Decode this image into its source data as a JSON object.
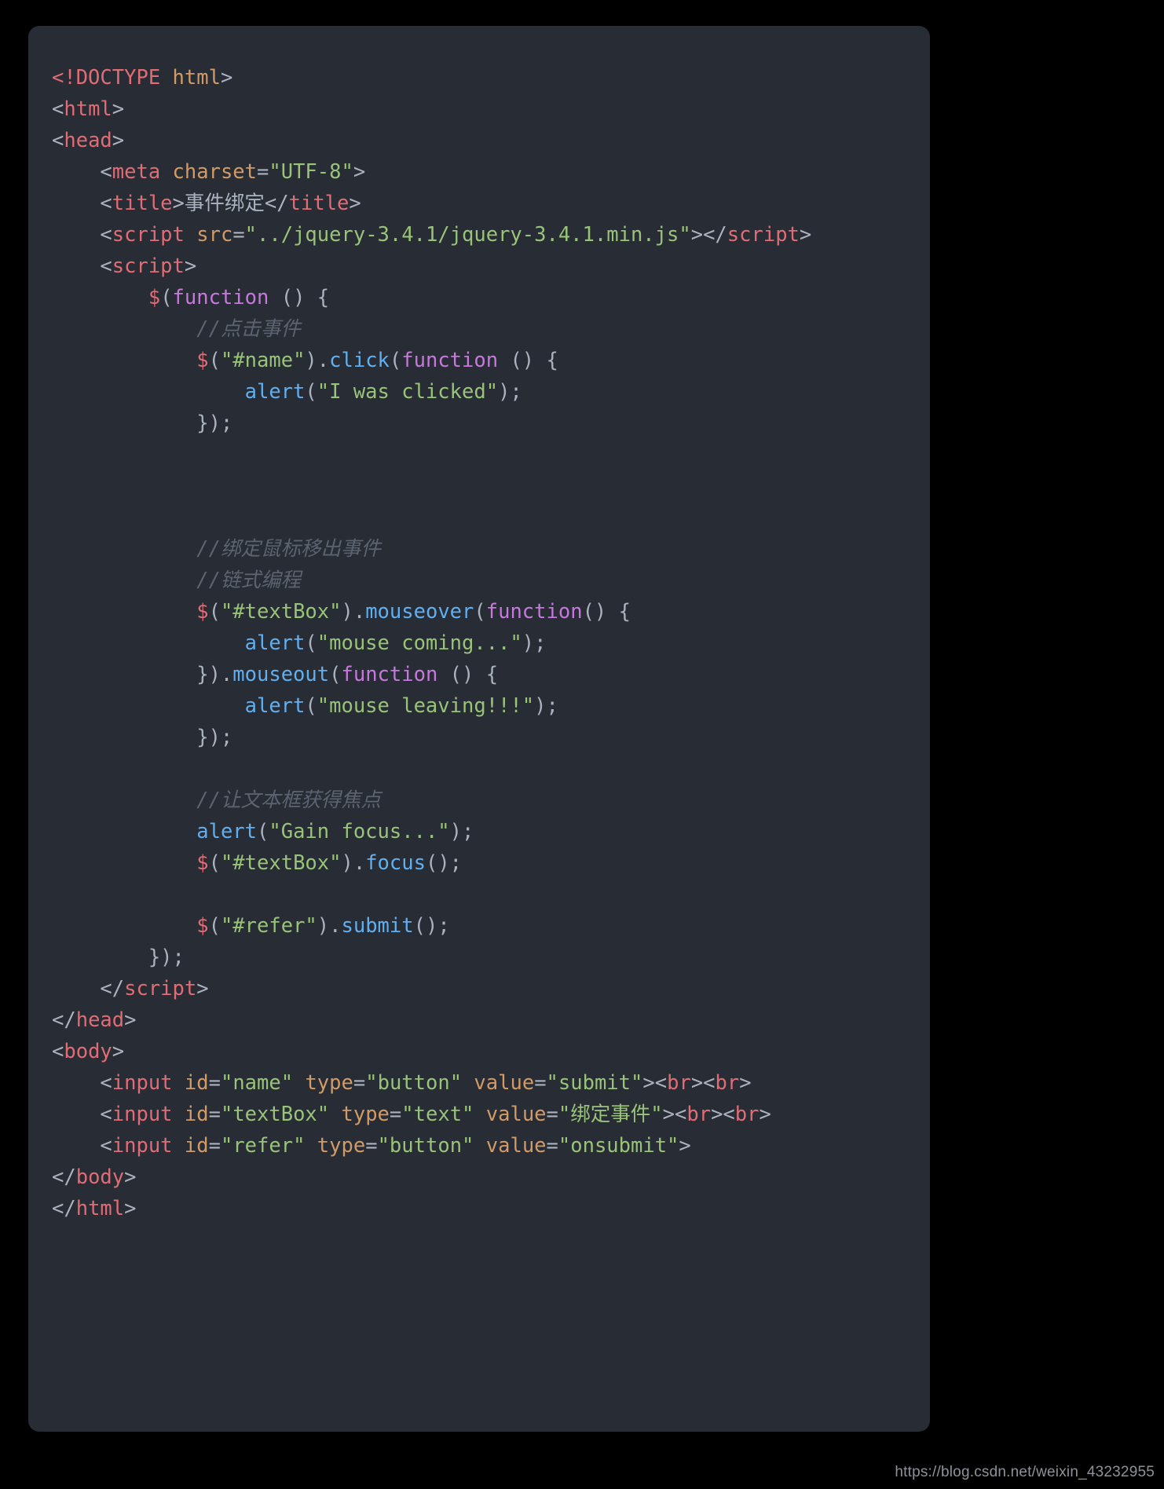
{
  "panel": {
    "background_color": "#282c34",
    "page_background_color": "#000000"
  },
  "palette": {
    "punctuation": "#abb2bf",
    "tag": "#e06c75",
    "attribute": "#d19a66",
    "string": "#98c379",
    "comment": "#5c6370",
    "function": "#61afef",
    "keyword": "#c678dd",
    "variable": "#e06c75",
    "plain_text": "#abb2bf"
  },
  "watermark": {
    "text": "https://blog.csdn.net/weixin_43232955"
  },
  "code": {
    "language": "html",
    "lines": [
      {
        "n": 1,
        "tokens": [
          {
            "t": "<!DOCTYPE ",
            "c": "doctype"
          },
          {
            "t": "html",
            "c": "attr"
          },
          {
            "t": ">",
            "c": "punct"
          }
        ]
      },
      {
        "n": 2,
        "tokens": [
          {
            "t": "<",
            "c": "punct"
          },
          {
            "t": "html",
            "c": "tag"
          },
          {
            "t": ">",
            "c": "punct"
          }
        ]
      },
      {
        "n": 3,
        "tokens": [
          {
            "t": "<",
            "c": "punct"
          },
          {
            "t": "head",
            "c": "tag"
          },
          {
            "t": ">",
            "c": "punct"
          }
        ]
      },
      {
        "n": 4,
        "tokens": [
          {
            "t": "    <",
            "c": "punct"
          },
          {
            "t": "meta",
            "c": "tag"
          },
          {
            "t": " ",
            "c": "punct"
          },
          {
            "t": "charset",
            "c": "attr"
          },
          {
            "t": "=",
            "c": "punct"
          },
          {
            "t": "\"UTF-8\"",
            "c": "string"
          },
          {
            "t": ">",
            "c": "punct"
          }
        ]
      },
      {
        "n": 5,
        "tokens": [
          {
            "t": "    <",
            "c": "punct"
          },
          {
            "t": "title",
            "c": "tag"
          },
          {
            "t": ">",
            "c": "punct"
          },
          {
            "t": "事件绑定",
            "c": "text"
          },
          {
            "t": "</",
            "c": "punct"
          },
          {
            "t": "title",
            "c": "tag"
          },
          {
            "t": ">",
            "c": "punct"
          }
        ]
      },
      {
        "n": 6,
        "tokens": [
          {
            "t": "    <",
            "c": "punct"
          },
          {
            "t": "script",
            "c": "tag"
          },
          {
            "t": " ",
            "c": "punct"
          },
          {
            "t": "src",
            "c": "attr"
          },
          {
            "t": "=",
            "c": "punct"
          },
          {
            "t": "\"../jquery-3.4.1/jquery-3.4.1.min.js\"",
            "c": "string"
          },
          {
            "t": "></",
            "c": "punct"
          },
          {
            "t": "script",
            "c": "tag"
          },
          {
            "t": ">",
            "c": "punct"
          }
        ]
      },
      {
        "n": 7,
        "tokens": [
          {
            "t": "    <",
            "c": "punct"
          },
          {
            "t": "script",
            "c": "tag"
          },
          {
            "t": ">",
            "c": "punct"
          }
        ]
      },
      {
        "n": 8,
        "tokens": [
          {
            "t": "        ",
            "c": "punct"
          },
          {
            "t": "$",
            "c": "dollar"
          },
          {
            "t": "(",
            "c": "punct"
          },
          {
            "t": "function",
            "c": "kw"
          },
          {
            "t": " () {",
            "c": "punct"
          }
        ]
      },
      {
        "n": 9,
        "tokens": [
          {
            "t": "            //点击事件",
            "c": "comment"
          }
        ]
      },
      {
        "n": 10,
        "tokens": [
          {
            "t": "            ",
            "c": "punct"
          },
          {
            "t": "$",
            "c": "dollar"
          },
          {
            "t": "(",
            "c": "punct"
          },
          {
            "t": "\"#name\"",
            "c": "string"
          },
          {
            "t": ").",
            "c": "punct"
          },
          {
            "t": "click",
            "c": "func"
          },
          {
            "t": "(",
            "c": "punct"
          },
          {
            "t": "function",
            "c": "kw"
          },
          {
            "t": " () {",
            "c": "punct"
          }
        ]
      },
      {
        "n": 11,
        "tokens": [
          {
            "t": "                ",
            "c": "punct"
          },
          {
            "t": "alert",
            "c": "func"
          },
          {
            "t": "(",
            "c": "punct"
          },
          {
            "t": "\"I was clicked\"",
            "c": "string"
          },
          {
            "t": ");",
            "c": "punct"
          }
        ]
      },
      {
        "n": 12,
        "tokens": [
          {
            "t": "            });",
            "c": "punct"
          }
        ]
      },
      {
        "n": 13,
        "tokens": []
      },
      {
        "n": 14,
        "tokens": []
      },
      {
        "n": 15,
        "tokens": []
      },
      {
        "n": 16,
        "tokens": [
          {
            "t": "            //绑定鼠标移出事件",
            "c": "comment"
          }
        ]
      },
      {
        "n": 17,
        "tokens": [
          {
            "t": "            //链式编程",
            "c": "comment"
          }
        ]
      },
      {
        "n": 18,
        "tokens": [
          {
            "t": "            ",
            "c": "punct"
          },
          {
            "t": "$",
            "c": "dollar"
          },
          {
            "t": "(",
            "c": "punct"
          },
          {
            "t": "\"#textBox\"",
            "c": "string"
          },
          {
            "t": ").",
            "c": "punct"
          },
          {
            "t": "mouseover",
            "c": "func"
          },
          {
            "t": "(",
            "c": "punct"
          },
          {
            "t": "function",
            "c": "kw"
          },
          {
            "t": "() {",
            "c": "punct"
          }
        ]
      },
      {
        "n": 19,
        "tokens": [
          {
            "t": "                ",
            "c": "punct"
          },
          {
            "t": "alert",
            "c": "func"
          },
          {
            "t": "(",
            "c": "punct"
          },
          {
            "t": "\"mouse coming...\"",
            "c": "string"
          },
          {
            "t": ");",
            "c": "punct"
          }
        ]
      },
      {
        "n": 20,
        "tokens": [
          {
            "t": "            }).",
            "c": "punct"
          },
          {
            "t": "mouseout",
            "c": "func"
          },
          {
            "t": "(",
            "c": "punct"
          },
          {
            "t": "function",
            "c": "kw"
          },
          {
            "t": " () {",
            "c": "punct"
          }
        ]
      },
      {
        "n": 21,
        "tokens": [
          {
            "t": "                ",
            "c": "punct"
          },
          {
            "t": "alert",
            "c": "func"
          },
          {
            "t": "(",
            "c": "punct"
          },
          {
            "t": "\"mouse leaving!!!\"",
            "c": "string"
          },
          {
            "t": ");",
            "c": "punct"
          }
        ]
      },
      {
        "n": 22,
        "tokens": [
          {
            "t": "            });",
            "c": "punct"
          }
        ]
      },
      {
        "n": 23,
        "tokens": []
      },
      {
        "n": 24,
        "tokens": [
          {
            "t": "            //让文本框获得焦点",
            "c": "comment"
          }
        ]
      },
      {
        "n": 25,
        "tokens": [
          {
            "t": "            ",
            "c": "punct"
          },
          {
            "t": "alert",
            "c": "func"
          },
          {
            "t": "(",
            "c": "punct"
          },
          {
            "t": "\"Gain focus...\"",
            "c": "string"
          },
          {
            "t": ");",
            "c": "punct"
          }
        ]
      },
      {
        "n": 26,
        "tokens": [
          {
            "t": "            ",
            "c": "punct"
          },
          {
            "t": "$",
            "c": "dollar"
          },
          {
            "t": "(",
            "c": "punct"
          },
          {
            "t": "\"#textBox\"",
            "c": "string"
          },
          {
            "t": ").",
            "c": "punct"
          },
          {
            "t": "focus",
            "c": "func"
          },
          {
            "t": "();",
            "c": "punct"
          }
        ]
      },
      {
        "n": 27,
        "tokens": []
      },
      {
        "n": 28,
        "tokens": [
          {
            "t": "            ",
            "c": "punct"
          },
          {
            "t": "$",
            "c": "dollar"
          },
          {
            "t": "(",
            "c": "punct"
          },
          {
            "t": "\"#refer\"",
            "c": "string"
          },
          {
            "t": ").",
            "c": "punct"
          },
          {
            "t": "submit",
            "c": "func"
          },
          {
            "t": "();",
            "c": "punct"
          }
        ]
      },
      {
        "n": 29,
        "tokens": [
          {
            "t": "        });",
            "c": "punct"
          }
        ]
      },
      {
        "n": 30,
        "tokens": [
          {
            "t": "    </",
            "c": "punct"
          },
          {
            "t": "script",
            "c": "tag"
          },
          {
            "t": ">",
            "c": "punct"
          }
        ]
      },
      {
        "n": 31,
        "tokens": [
          {
            "t": "</",
            "c": "punct"
          },
          {
            "t": "head",
            "c": "tag"
          },
          {
            "t": ">",
            "c": "punct"
          }
        ]
      },
      {
        "n": 32,
        "tokens": [
          {
            "t": "<",
            "c": "punct"
          },
          {
            "t": "body",
            "c": "tag"
          },
          {
            "t": ">",
            "c": "punct"
          }
        ]
      },
      {
        "n": 33,
        "tokens": [
          {
            "t": "    <",
            "c": "punct"
          },
          {
            "t": "input",
            "c": "tag"
          },
          {
            "t": " ",
            "c": "punct"
          },
          {
            "t": "id",
            "c": "attr"
          },
          {
            "t": "=",
            "c": "punct"
          },
          {
            "t": "\"name\"",
            "c": "string"
          },
          {
            "t": " ",
            "c": "punct"
          },
          {
            "t": "type",
            "c": "attr"
          },
          {
            "t": "=",
            "c": "punct"
          },
          {
            "t": "\"button\"",
            "c": "string"
          },
          {
            "t": " ",
            "c": "punct"
          },
          {
            "t": "value",
            "c": "attr"
          },
          {
            "t": "=",
            "c": "punct"
          },
          {
            "t": "\"submit\"",
            "c": "string"
          },
          {
            "t": "><",
            "c": "punct"
          },
          {
            "t": "br",
            "c": "tag"
          },
          {
            "t": "><",
            "c": "punct"
          },
          {
            "t": "br",
            "c": "tag"
          },
          {
            "t": ">",
            "c": "punct"
          }
        ]
      },
      {
        "n": 34,
        "tokens": [
          {
            "t": "    <",
            "c": "punct"
          },
          {
            "t": "input",
            "c": "tag"
          },
          {
            "t": " ",
            "c": "punct"
          },
          {
            "t": "id",
            "c": "attr"
          },
          {
            "t": "=",
            "c": "punct"
          },
          {
            "t": "\"textBox\"",
            "c": "string"
          },
          {
            "t": " ",
            "c": "punct"
          },
          {
            "t": "type",
            "c": "attr"
          },
          {
            "t": "=",
            "c": "punct"
          },
          {
            "t": "\"text\"",
            "c": "string"
          },
          {
            "t": " ",
            "c": "punct"
          },
          {
            "t": "value",
            "c": "attr"
          },
          {
            "t": "=",
            "c": "punct"
          },
          {
            "t": "\"绑定事件\"",
            "c": "string"
          },
          {
            "t": "><",
            "c": "punct"
          },
          {
            "t": "br",
            "c": "tag"
          },
          {
            "t": "><",
            "c": "punct"
          },
          {
            "t": "br",
            "c": "tag"
          },
          {
            "t": ">",
            "c": "punct"
          }
        ]
      },
      {
        "n": 35,
        "tokens": [
          {
            "t": "    <",
            "c": "punct"
          },
          {
            "t": "input",
            "c": "tag"
          },
          {
            "t": " ",
            "c": "punct"
          },
          {
            "t": "id",
            "c": "attr"
          },
          {
            "t": "=",
            "c": "punct"
          },
          {
            "t": "\"refer\"",
            "c": "string"
          },
          {
            "t": " ",
            "c": "punct"
          },
          {
            "t": "type",
            "c": "attr"
          },
          {
            "t": "=",
            "c": "punct"
          },
          {
            "t": "\"button\"",
            "c": "string"
          },
          {
            "t": " ",
            "c": "punct"
          },
          {
            "t": "value",
            "c": "attr"
          },
          {
            "t": "=",
            "c": "punct"
          },
          {
            "t": "\"onsubmit\"",
            "c": "string"
          },
          {
            "t": ">",
            "c": "punct"
          }
        ]
      },
      {
        "n": 36,
        "tokens": [
          {
            "t": "</",
            "c": "punct"
          },
          {
            "t": "body",
            "c": "tag"
          },
          {
            "t": ">",
            "c": "punct"
          }
        ]
      },
      {
        "n": 37,
        "tokens": [
          {
            "t": "</",
            "c": "punct"
          },
          {
            "t": "html",
            "c": "tag"
          },
          {
            "t": ">",
            "c": "punct"
          }
        ]
      }
    ]
  }
}
